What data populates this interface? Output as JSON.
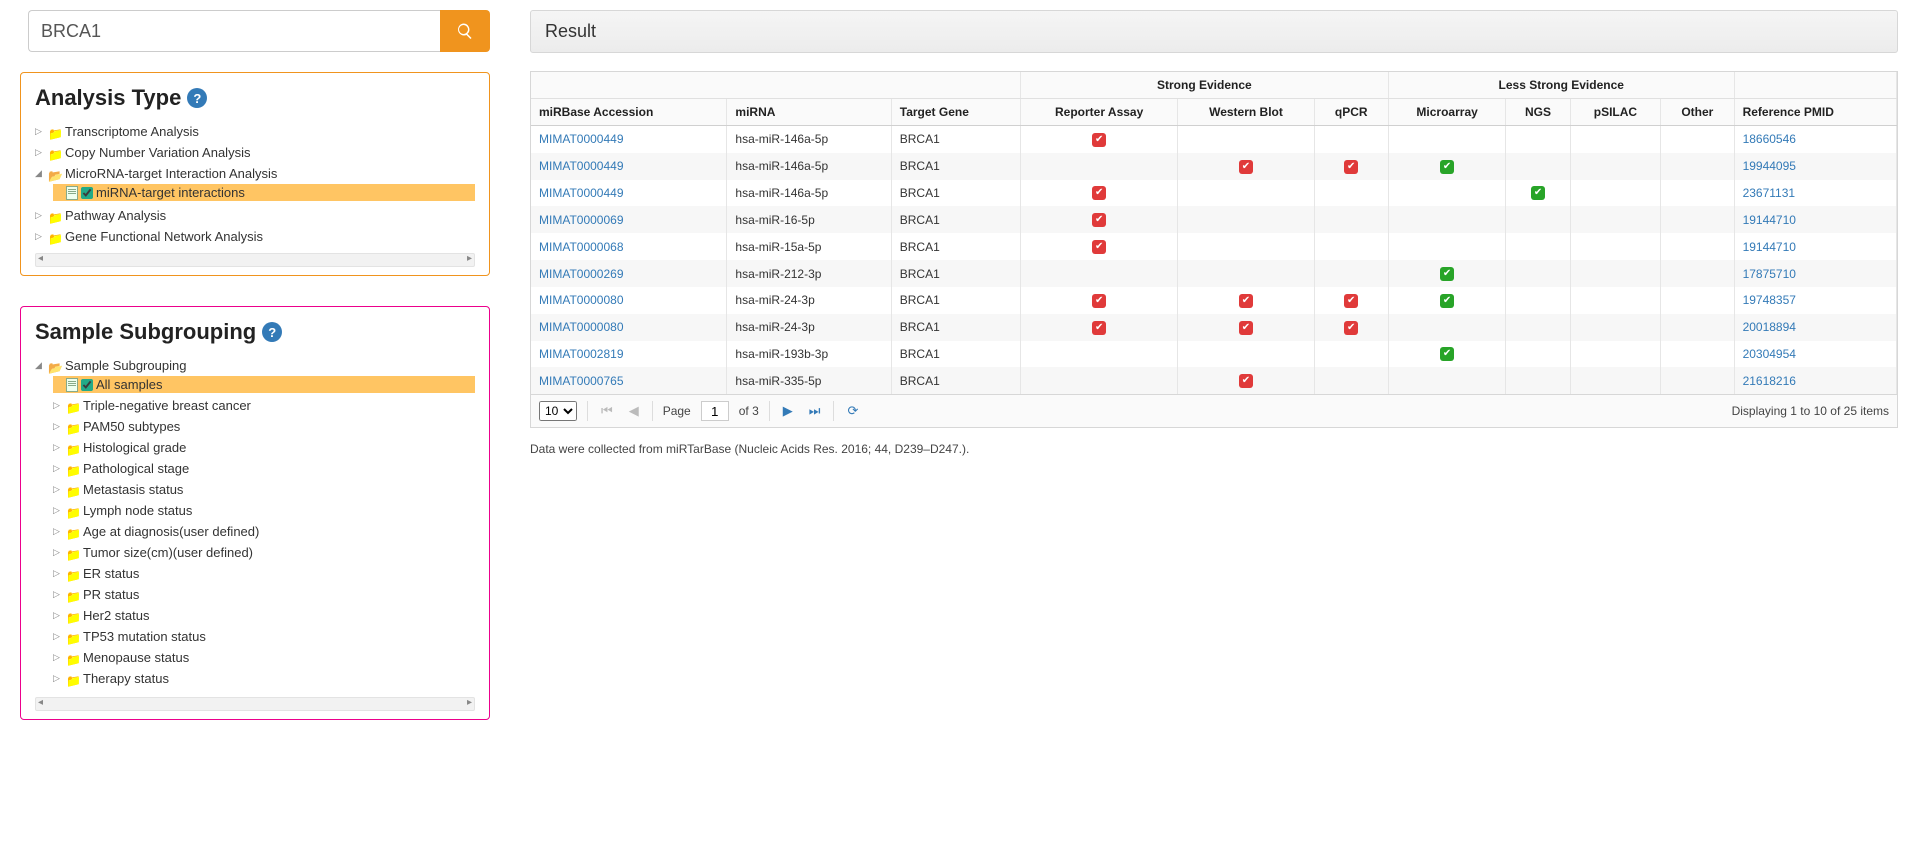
{
  "search": {
    "value": "BRCA1"
  },
  "analysis_panel": {
    "title": "Analysis Type",
    "items": [
      {
        "label": "Transcriptome Analysis",
        "expanded": false
      },
      {
        "label": "Copy Number Variation Analysis",
        "expanded": false
      },
      {
        "label": "MicroRNA-target Interaction Analysis",
        "expanded": true,
        "children": [
          {
            "label": "miRNA-target interactions",
            "leaf": true,
            "selected": true,
            "checked": true
          }
        ]
      },
      {
        "label": "Pathway Analysis",
        "expanded": false
      },
      {
        "label": "Gene Functional Network Analysis",
        "expanded": false
      }
    ]
  },
  "subgroup_panel": {
    "title": "Sample Subgrouping",
    "root": {
      "label": "Sample Subgrouping",
      "expanded": true,
      "children": [
        {
          "label": "All samples",
          "leaf": true,
          "selected": true,
          "checked": true
        },
        {
          "label": "Triple-negative breast cancer"
        },
        {
          "label": "PAM50 subtypes"
        },
        {
          "label": "Histological grade"
        },
        {
          "label": "Pathological stage"
        },
        {
          "label": "Metastasis status"
        },
        {
          "label": "Lymph node status"
        },
        {
          "label": "Age at diagnosis(user defined)"
        },
        {
          "label": "Tumor size(cm)(user defined)"
        },
        {
          "label": "ER status"
        },
        {
          "label": "PR status"
        },
        {
          "label": "Her2 status"
        },
        {
          "label": "TP53 mutation status"
        },
        {
          "label": "Menopause status"
        },
        {
          "label": "Therapy status"
        }
      ]
    }
  },
  "result": {
    "title": "Result",
    "group_headers": {
      "strong": "Strong Evidence",
      "less": "Less Strong Evidence"
    },
    "columns": {
      "acc": "miRBase Accession",
      "mirna": "miRNA",
      "target": "Target Gene",
      "reporter": "Reporter Assay",
      "western": "Western Blot",
      "qpcr": "qPCR",
      "microarray": "Microarray",
      "ngs": "NGS",
      "psilac": "pSILAC",
      "other": "Other",
      "pmid": "Reference PMID"
    },
    "rows": [
      {
        "acc": "MIMAT0000449",
        "mirna": "hsa-miR-146a-5p",
        "target": "BRCA1",
        "reporter": "r",
        "western": "",
        "qpcr": "",
        "microarray": "",
        "ngs": "",
        "psilac": "",
        "other": "",
        "pmid": "18660546"
      },
      {
        "acc": "MIMAT0000449",
        "mirna": "hsa-miR-146a-5p",
        "target": "BRCA1",
        "reporter": "",
        "western": "r",
        "qpcr": "r",
        "microarray": "g",
        "ngs": "",
        "psilac": "",
        "other": "",
        "pmid": "19944095"
      },
      {
        "acc": "MIMAT0000449",
        "mirna": "hsa-miR-146a-5p",
        "target": "BRCA1",
        "reporter": "r",
        "western": "",
        "qpcr": "",
        "microarray": "",
        "ngs": "g",
        "psilac": "",
        "other": "",
        "pmid": "23671131"
      },
      {
        "acc": "MIMAT0000069",
        "mirna": "hsa-miR-16-5p",
        "target": "BRCA1",
        "reporter": "r",
        "western": "",
        "qpcr": "",
        "microarray": "",
        "ngs": "",
        "psilac": "",
        "other": "",
        "pmid": "19144710"
      },
      {
        "acc": "MIMAT0000068",
        "mirna": "hsa-miR-15a-5p",
        "target": "BRCA1",
        "reporter": "r",
        "western": "",
        "qpcr": "",
        "microarray": "",
        "ngs": "",
        "psilac": "",
        "other": "",
        "pmid": "19144710"
      },
      {
        "acc": "MIMAT0000269",
        "mirna": "hsa-miR-212-3p",
        "target": "BRCA1",
        "reporter": "",
        "western": "",
        "qpcr": "",
        "microarray": "g",
        "ngs": "",
        "psilac": "",
        "other": "",
        "pmid": "17875710"
      },
      {
        "acc": "MIMAT0000080",
        "mirna": "hsa-miR-24-3p",
        "target": "BRCA1",
        "reporter": "r",
        "western": "r",
        "qpcr": "r",
        "microarray": "g",
        "ngs": "",
        "psilac": "",
        "other": "",
        "pmid": "19748357"
      },
      {
        "acc": "MIMAT0000080",
        "mirna": "hsa-miR-24-3p",
        "target": "BRCA1",
        "reporter": "r",
        "western": "r",
        "qpcr": "r",
        "microarray": "",
        "ngs": "",
        "psilac": "",
        "other": "",
        "pmid": "20018894"
      },
      {
        "acc": "MIMAT0002819",
        "mirna": "hsa-miR-193b-3p",
        "target": "BRCA1",
        "reporter": "",
        "western": "",
        "qpcr": "",
        "microarray": "g",
        "ngs": "",
        "psilac": "",
        "other": "",
        "pmid": "20304954"
      },
      {
        "acc": "MIMAT0000765",
        "mirna": "hsa-miR-335-5p",
        "target": "BRCA1",
        "reporter": "",
        "western": "r",
        "qpcr": "",
        "microarray": "",
        "ngs": "",
        "psilac": "",
        "other": "",
        "pmid": "21618216"
      }
    ],
    "pager": {
      "page_size": "10",
      "page_label_prefix": "Page",
      "page": "1",
      "of_label": "of 3",
      "summary": "Displaying 1 to 10 of 25 items"
    },
    "footnote": "Data were collected from miRTarBase (Nucleic Acids Res. 2016; 44, D239–D247.)."
  }
}
